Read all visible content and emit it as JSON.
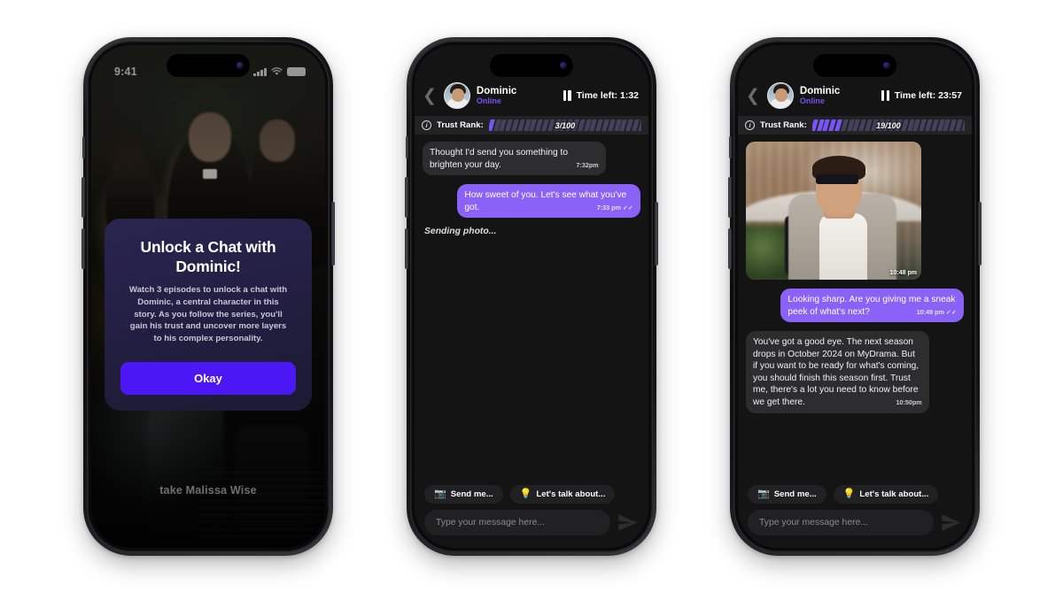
{
  "phone1": {
    "status_bar": {
      "time": "9:41",
      "signal_icon": "cellular-signal-icon",
      "wifi_icon": "wifi-icon",
      "battery_icon": "battery-icon"
    },
    "video_caption": "take Malissa Wise",
    "modal": {
      "title": "Unlock a Chat with Dominic!",
      "body": "Watch 3 episodes to unlock a chat with Dominic, a central character in this story. As you follow the series, you'll gain his trust and uncover more layers to his complex personality.",
      "button_label": "Okay",
      "accent_color": "#4b17f5"
    }
  },
  "phone2": {
    "header": {
      "back_icon": "chevron-left-icon",
      "avatar_name": "dominic-avatar",
      "name": "Dominic",
      "status": "Online",
      "pause_icon": "pause-icon",
      "time_left": "Time left: 1:32"
    },
    "trust": {
      "info_icon": "info-icon",
      "label": "Trust Rank:",
      "value": "3/100",
      "current": 3,
      "max": 100,
      "segments": 26,
      "filled_segments": 1,
      "fill_color": "#7a55f5",
      "track_color": "#45405c"
    },
    "messages": [
      {
        "from": "them",
        "text": "Thought I'd send you something to brighten your day.",
        "time": "7:32pm"
      },
      {
        "from": "me",
        "text": "How sweet of you. Let's see what you've got.",
        "time": "7:33 pm",
        "read_receipt": "✓✓"
      }
    ],
    "typing_status": "Sending photo...",
    "chips": [
      {
        "icon": "camera-photo-icon",
        "glyph": "📷",
        "label": "Send me..."
      },
      {
        "icon": "lightbulb-icon",
        "glyph": "💡",
        "label": "Let's talk about..."
      }
    ],
    "composer": {
      "placeholder": "Type your message here...",
      "value": "",
      "send_icon": "send-paper-plane-icon"
    }
  },
  "phone3": {
    "header": {
      "back_icon": "chevron-left-icon",
      "avatar_name": "dominic-avatar",
      "name": "Dominic",
      "status": "Online",
      "pause_icon": "pause-icon",
      "time_left": "Time left: 23:57"
    },
    "trust": {
      "info_icon": "info-icon",
      "label": "Trust Rank:",
      "value": "19/100",
      "current": 19,
      "max": 100,
      "segments": 26,
      "filled_segments": 5,
      "fill_color": "#7a55f5",
      "track_color": "#45405c"
    },
    "photo_message": {
      "alt": "man-in-sunglasses-photo",
      "time": "10:48 pm"
    },
    "messages": [
      {
        "from": "me",
        "text": "Looking sharp. Are you giving me a sneak peek of what's next?",
        "time": "10:49 pm",
        "read_receipt": "✓✓"
      },
      {
        "from": "them",
        "text": "You've got a good eye. The next season drops in October 2024 on MyDrama. But if you want to be ready for what's coming, you should finish this season first. Trust me, there's a lot you need to know before we get there.",
        "time": "10:50pm"
      }
    ],
    "chips": [
      {
        "icon": "camera-photo-icon",
        "glyph": "📷",
        "label": "Send me..."
      },
      {
        "icon": "lightbulb-icon",
        "glyph": "💡",
        "label": "Let's talk about..."
      }
    ],
    "composer": {
      "placeholder": "Type your message here...",
      "value": "",
      "send_icon": "send-paper-plane-icon"
    }
  }
}
